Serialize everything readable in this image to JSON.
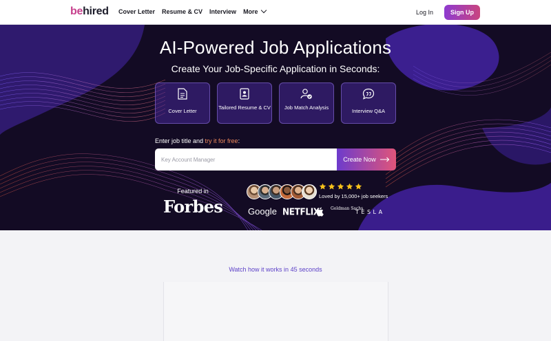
{
  "nav": {
    "logo_prefix": "be",
    "logo_suffix": "hired",
    "links": [
      "Cover Letter",
      "Resume & CV",
      "Interview",
      "More"
    ],
    "login": "Log In",
    "signup": "Sign Up"
  },
  "hero": {
    "title": "AI-Powered Job Applications",
    "subtitle": "Create Your Job-Specific Application in Seconds:",
    "features": [
      {
        "label": "Cover Letter",
        "icon": "document-icon"
      },
      {
        "label": "Tailored Resume & CV",
        "icon": "resume-icon"
      },
      {
        "label": "Job Match Analysis",
        "icon": "user-check-icon"
      },
      {
        "label": "Interview Q&A",
        "icon": "chat-quote-icon"
      }
    ],
    "prompt_text": "Enter job title and ",
    "prompt_accent": "try it for free",
    "prompt_end": ":",
    "search_placeholder": "Key Account Manager",
    "cta": "Create Now",
    "featured_in": "Featured in",
    "featured_brand": "Forbes",
    "rating_stars": 5,
    "loved_by": "Loved by 15,000+ job seekers",
    "brands": {
      "google": "Google",
      "netflix": "NETFLIX",
      "goldman": "Goldman Sachs",
      "tesla": "TESLA"
    },
    "colors": {
      "background": "#130b24",
      "accent": "#f08a5d",
      "primary": "#8e3bd0"
    }
  },
  "lower": {
    "watch_text": "Watch how it works in 45 seconds"
  }
}
